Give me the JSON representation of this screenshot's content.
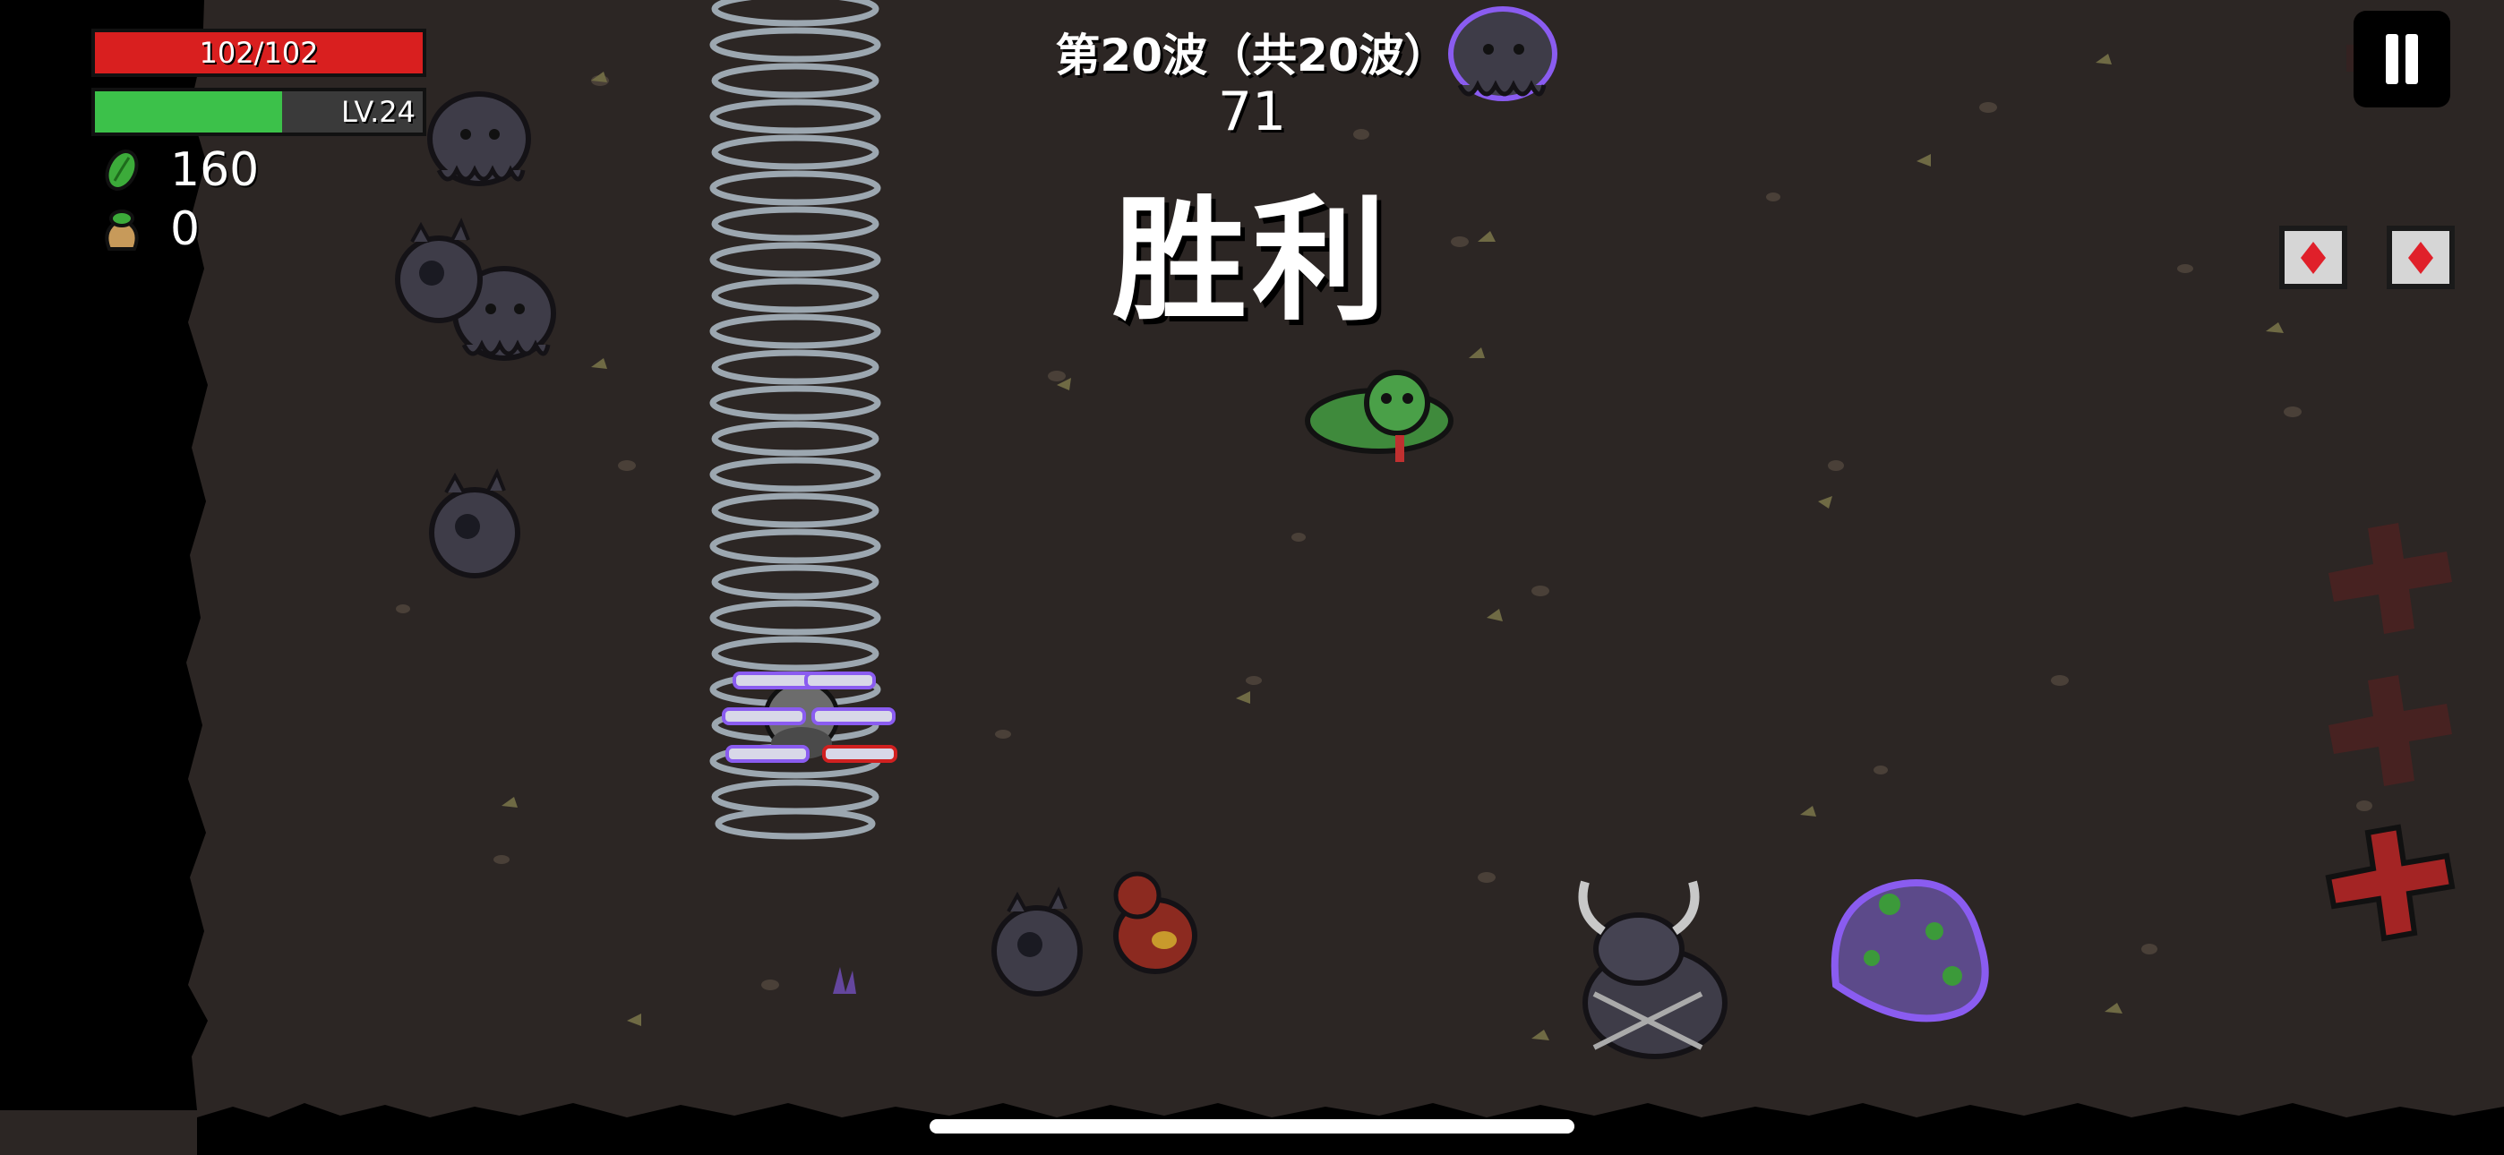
{
  "hud": {
    "health": {
      "text": "102/102",
      "current": 102,
      "max": 102,
      "color": "#d91f1f"
    },
    "level": {
      "text": "LV.24",
      "progress": 0.57,
      "color": "#3cc14a"
    },
    "materials": {
      "value": "160",
      "icon": "green-leaf-material-icon"
    },
    "bag": {
      "value": "0",
      "icon": "money-bag-icon"
    },
    "wave_label": "第20波（共20波）",
    "timer": "71",
    "result": "胜利"
  },
  "colors": {
    "ground": "#2c2624",
    "dirt_dark": "#1e1917",
    "tornado": "#b8c8d4",
    "enemy_body": "#3e3c48",
    "enemy_outline": "#141216",
    "glow_purple": "#8a5cf0",
    "red_cross_faded": "#5a2020",
    "red_cross": "#a42424",
    "crate_red": "#e0202a"
  },
  "sprites": [
    "cthulhu-enemy",
    "cthulhu-enemy",
    "cthulhu-enemy",
    "cthulhu-enemy-elite",
    "spiky-eye-enemy",
    "spiky-eye-enemy",
    "spiky-eye-enemy",
    "green-caterpillar-enemy",
    "red-slug-enemy",
    "horned-brute-enemy",
    "toxic-blob-boss",
    "player-with-guns",
    "tornado-weapon",
    "loot-crate",
    "loot-crate",
    "consumable-cross"
  ]
}
